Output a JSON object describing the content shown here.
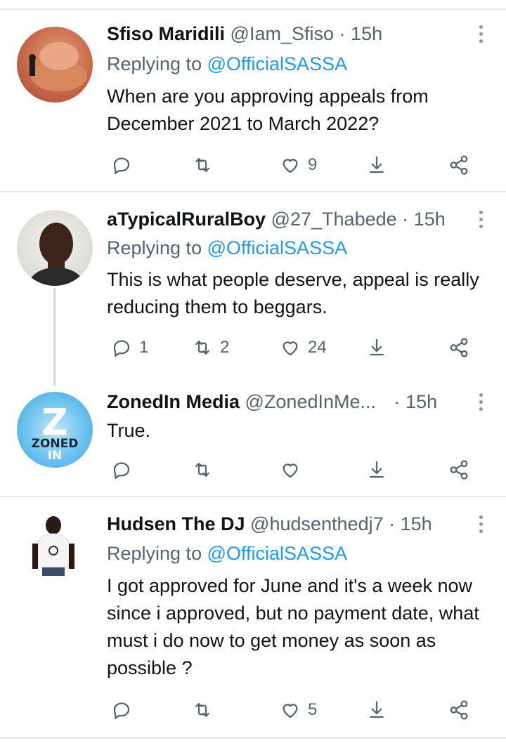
{
  "tweets": [
    {
      "name": "Sfiso Maridili",
      "handle": "@Iam_Sfiso",
      "dot": "·",
      "time": "15h",
      "replying_prefix": "Replying to",
      "replying_to": "@OfficialSASSA",
      "text": "When are you approving appeals from December 2021 to March 2022?",
      "counts": {
        "reply": "",
        "retweet": "",
        "like": "9"
      }
    },
    {
      "name": "aTypicalRuralBoy",
      "handle": "@27_Thabede",
      "dot": "·",
      "time": "15h",
      "replying_prefix": "Replying to",
      "replying_to": "@OfficialSASSA",
      "text": "This is what people deserve, appeal is really reducing them to beggars.",
      "counts": {
        "reply": "1",
        "retweet": "2",
        "like": "24"
      }
    },
    {
      "name": "ZonedIn Media",
      "handle": "@ZonedInMe...",
      "dot": "·",
      "time": "15h",
      "avatar_text_top": "Z",
      "avatar_text_bottom": "ZONED",
      "avatar_text_bottom2": "IN",
      "text": "True.",
      "counts": {
        "reply": "",
        "retweet": "",
        "like": ""
      }
    },
    {
      "name": "Hudsen The DJ",
      "handle": "@hudsenthedj7",
      "dot": "·",
      "time": "15h",
      "replying_prefix": "Replying to",
      "replying_to": "@OfficialSASSA",
      "text": "I got approved for June and it's a week now since i approved, but no payment date, what must i do now to get money as soon as possible ?",
      "counts": {
        "reply": "",
        "retweet": "",
        "like": "5"
      }
    }
  ],
  "icons": [
    "reply-icon",
    "retweet-icon",
    "like-icon",
    "share-icon",
    "network-share-icon",
    "more-icon"
  ],
  "colors": {
    "accent": "#1d9bf0",
    "muted": "#536471",
    "divider": "#e6ebee"
  }
}
